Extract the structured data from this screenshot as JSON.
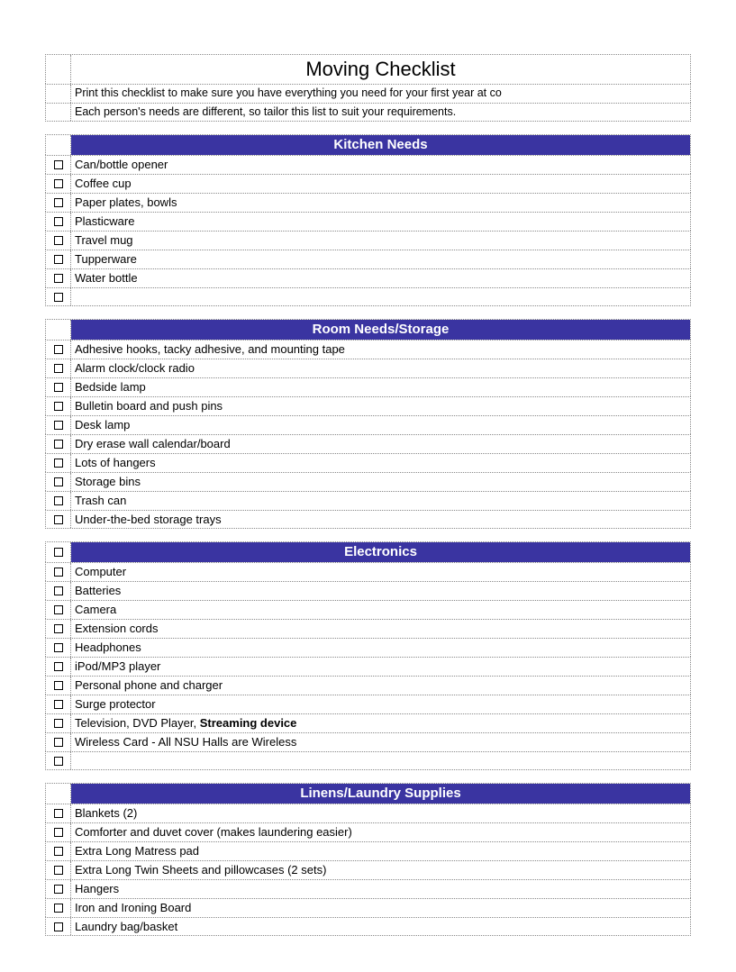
{
  "title": "Moving Checklist",
  "intro": [
    "Print this checklist to make sure you have everything you need for your first year at co",
    "Each person's needs are different, so tailor this list to suit your requirements."
  ],
  "sections": [
    {
      "name": "Kitchen Needs",
      "headerCheckbox": false,
      "items": [
        "Can/bottle opener",
        "Coffee cup",
        "Paper plates, bowls",
        "Plasticware",
        "Travel mug",
        "Tupperware",
        "Water bottle",
        ""
      ]
    },
    {
      "name": "Room Needs/Storage",
      "headerCheckbox": false,
      "items": [
        "Adhesive hooks, tacky adhesive, and mounting tape",
        "Alarm clock/clock radio",
        "Bedside lamp",
        "Bulletin board and push pins",
        "Desk lamp",
        "Dry erase wall calendar/board",
        "Lots of hangers",
        "Storage bins",
        "Trash can",
        "Under-the-bed storage trays"
      ]
    },
    {
      "name": "Electronics",
      "headerCheckbox": true,
      "items": [
        "Computer",
        "Batteries",
        "Camera",
        "Extension cords",
        "Headphones",
        "iPod/MP3 player",
        "Personal phone and charger",
        "Surge protector",
        {
          "prefix": "Television, DVD Player, ",
          "bold": "Streaming device"
        },
        "Wireless Card - All NSU Halls are Wireless",
        ""
      ]
    },
    {
      "name": "Linens/Laundry Supplies",
      "headerCheckbox": false,
      "items": [
        "Blankets (2)",
        "Comforter and duvet cover (makes laundering easier)",
        "Extra Long Matress pad",
        "Extra Long Twin Sheets and pillowcases (2 sets)",
        "Hangers",
        "Iron and Ironing Board",
        "Laundry bag/basket"
      ]
    }
  ]
}
